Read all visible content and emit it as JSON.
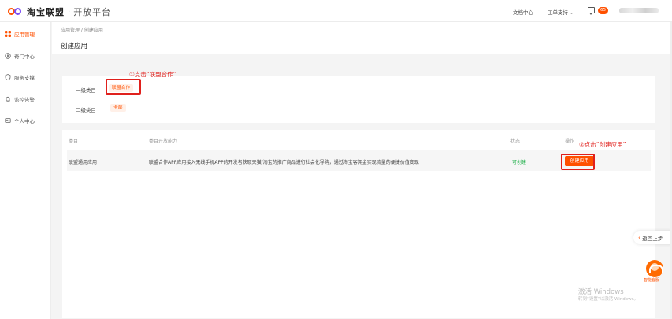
{
  "header": {
    "brand": "淘宝联盟",
    "separator": "·",
    "subtitle": "开放平台",
    "doc_center": "文档中心",
    "ticket_support": "工单支持",
    "message_count": "65"
  },
  "sidebar": {
    "items": [
      {
        "label": "应用管理",
        "icon": "grid-icon",
        "active": true
      },
      {
        "label": "奇门中心",
        "icon": "compass-icon",
        "active": false
      },
      {
        "label": "服务支撑",
        "icon": "shield-icon",
        "active": false
      },
      {
        "label": "监控告警",
        "icon": "bell-icon",
        "active": false
      },
      {
        "label": "个人中心",
        "icon": "user-icon",
        "active": false
      }
    ]
  },
  "main": {
    "breadcrumb": "应用管理 / 创建应用",
    "page_title": "创建应用",
    "filters": {
      "level1_label": "一级类目",
      "level1_chip": "联盟合作",
      "level2_label": "二级类目",
      "level2_chip": "全部"
    },
    "table": {
      "columns": [
        "类目",
        "类目开放能力",
        "状态",
        "操作"
      ],
      "rows": [
        {
          "category": "联盟通用应用",
          "capability": "联盟合作APP应用接入无线手机APP的开发者获取天猫/淘宝的推广商品进行社会化导购，通过淘宝客佣金实现流量的便捷价值变现",
          "status": "可创建",
          "action": "创建应用"
        }
      ]
    }
  },
  "annotations": {
    "step1": "①点击“联盟合作”",
    "step2": "②点击“创建应用”"
  },
  "floating": {
    "back_to_top": "返回上步",
    "service_label": "智能客服"
  },
  "watermark": {
    "line1": "激活 Windows",
    "line2": "转到“设置”以激活 Windows。"
  },
  "colors": {
    "accent": "#ff5000",
    "annotation": "#e0201c",
    "status_ok": "#22b14c"
  }
}
